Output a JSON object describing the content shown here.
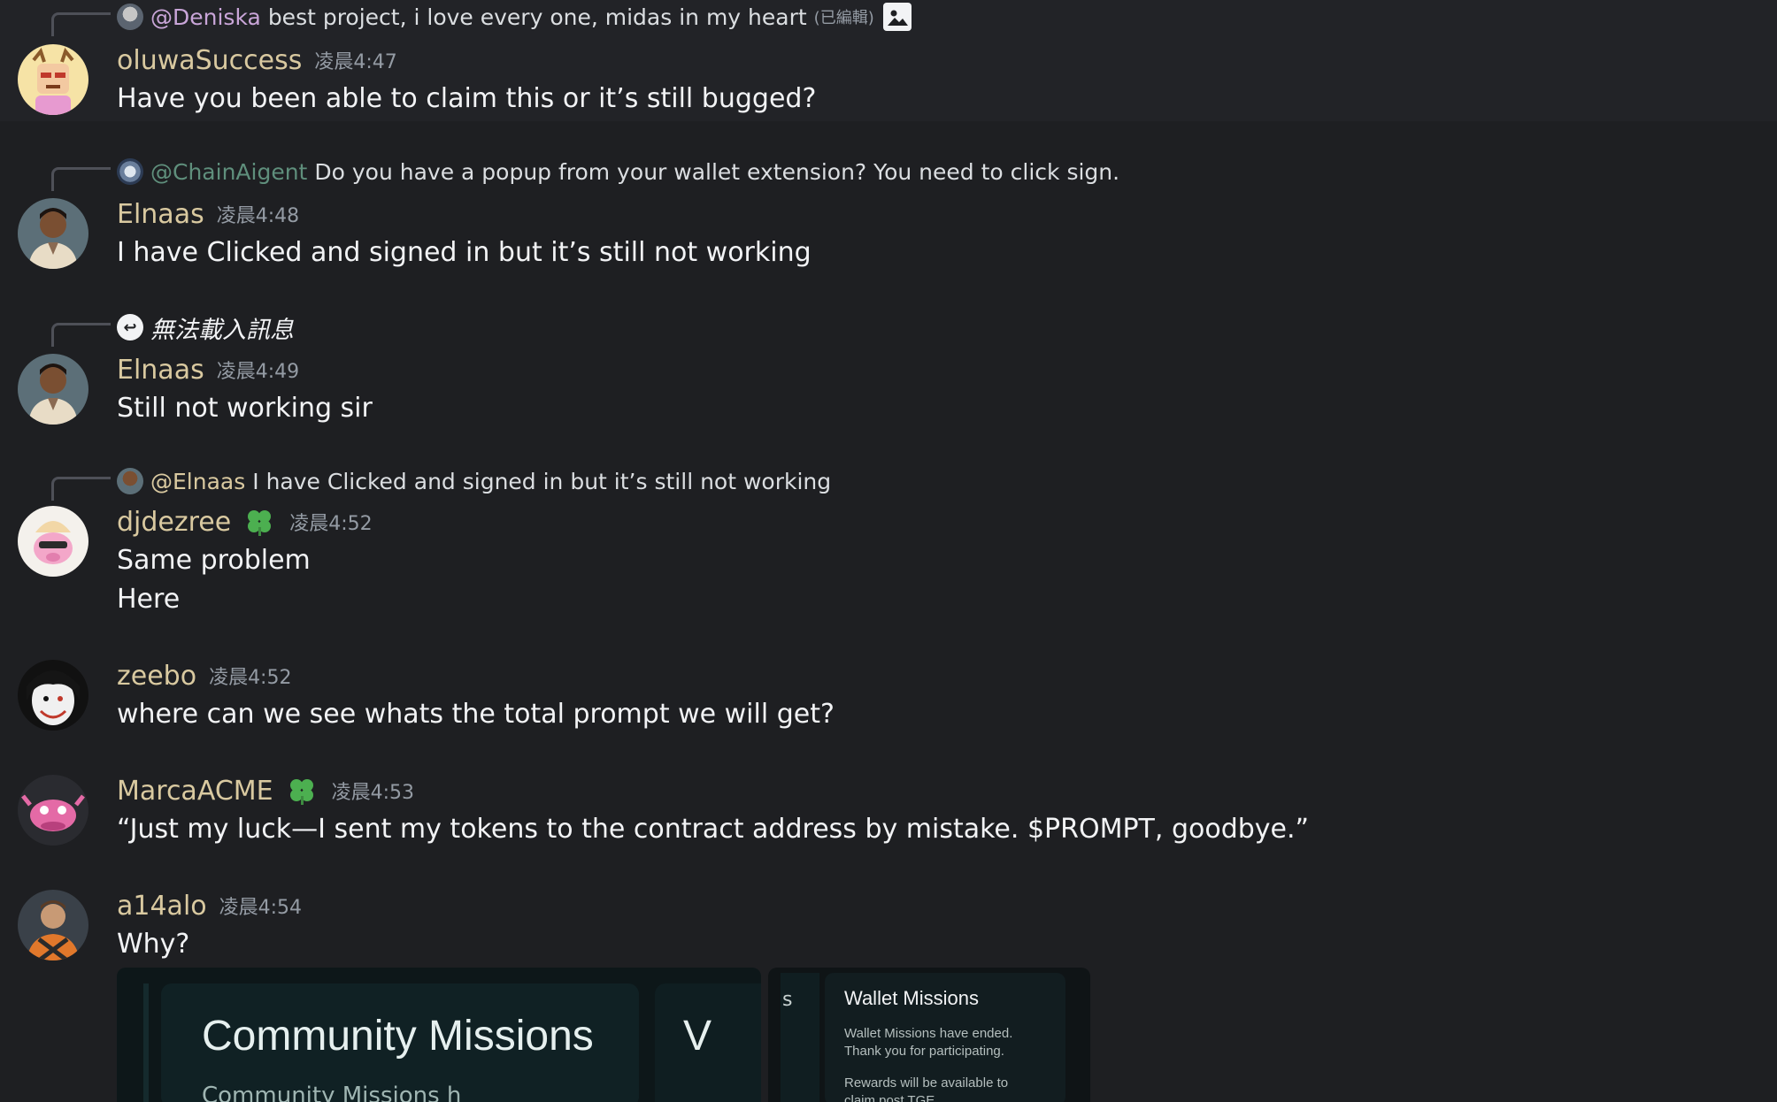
{
  "messages": [
    {
      "reply": {
        "mention": "@Deniska",
        "text": "best project, i love every one, midas in my heart",
        "edited": "(已編輯)"
      },
      "username": "oluwaSuccess",
      "time": "凌晨4:47",
      "lines": [
        "Have you been able to claim this or it’s still bugged?"
      ]
    },
    {
      "reply": {
        "mention": "@ChainAigent",
        "text": "Do you have a popup from your wallet extension? You need to click sign."
      },
      "username": "Elnaas",
      "time": "凌晨4:48",
      "lines": [
        "I have Clicked and signed in but it’s still not working"
      ]
    },
    {
      "reply": {
        "text": "無法載入訊息"
      },
      "username": "Elnaas",
      "time": "凌晨4:49",
      "lines": [
        "Still not working sir"
      ]
    },
    {
      "reply": {
        "mention": "@Elnaas",
        "text": "I have Clicked and signed in but it’s still not working"
      },
      "username": "djdezree",
      "time": "凌晨4:52",
      "lines": [
        "Same problem",
        "Here"
      ]
    },
    {
      "username": "zeebo",
      "time": "凌晨4:52",
      "lines": [
        "where can we see whats the total prompt we will get?"
      ]
    },
    {
      "username": "MarcaACME",
      "time": "凌晨4:53",
      "lines": [
        "“Just my luck—I sent my tokens to the contract address by mistake. $PROMPT, goodbye.”"
      ]
    },
    {
      "username": "a14alo",
      "time": "凌晨4:54",
      "lines": [
        "Why?"
      ]
    }
  ],
  "embeds": {
    "community": {
      "title": "Community Missions",
      "cut_text": "Community Missions h",
      "card2_letter": "V",
      "card2_cut": "W"
    },
    "wallet": {
      "side_letter": "s",
      "title": "Wallet Missions",
      "lines": [
        "Wallet Missions have ended.",
        "Thank you for participating.",
        "Rewards will be available to",
        "claim post TGE"
      ]
    }
  },
  "colors": {
    "background": "#1e1f22",
    "username": "#d9c9a0",
    "mention": "#c9a5d8",
    "timestamp": "#949ba4",
    "badge_green": "#4caf50"
  }
}
